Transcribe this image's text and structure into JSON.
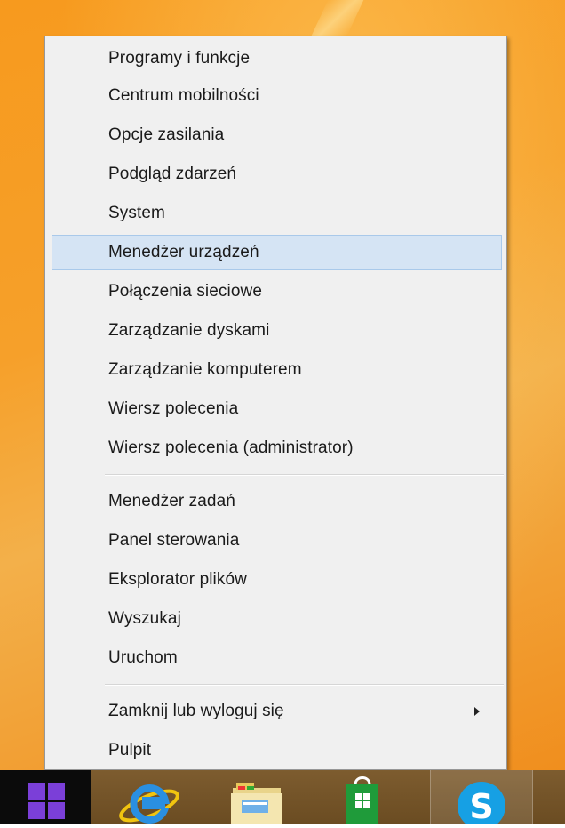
{
  "menu": {
    "group1": [
      {
        "label": "Programy i funkcje"
      },
      {
        "label": "Centrum mobilności"
      },
      {
        "label": "Opcje zasilania"
      },
      {
        "label": "Podgląd zdarzeń"
      },
      {
        "label": "System"
      },
      {
        "label": "Menedżer urządzeń"
      },
      {
        "label": "Połączenia sieciowe"
      },
      {
        "label": "Zarządzanie dyskami"
      },
      {
        "label": "Zarządzanie komputerem"
      },
      {
        "label": "Wiersz polecenia"
      },
      {
        "label": "Wiersz polecenia (administrator)"
      }
    ],
    "group2": [
      {
        "label": "Menedżer zadań"
      },
      {
        "label": "Panel sterowania"
      },
      {
        "label": "Eksplorator plików"
      },
      {
        "label": "Wyszukaj"
      },
      {
        "label": "Uruchom"
      }
    ],
    "group3": [
      {
        "label": "Zamknij lub wyloguj się"
      },
      {
        "label": "Pulpit"
      }
    ],
    "highlighted": "Menedżer urządzeń"
  },
  "taskbar": {
    "items": [
      {
        "icon": "start-windows-icon"
      },
      {
        "icon": "internet-explorer-icon"
      },
      {
        "icon": "file-explorer-icon"
      },
      {
        "icon": "windows-store-icon"
      },
      {
        "icon": "skype-icon"
      }
    ]
  },
  "colors": {
    "desktop": "#f6a02a",
    "menu_bg": "#f0f0f0",
    "highlight_bg": "#d5e4f4",
    "highlight_border": "#a9c9ea",
    "start_logo": "#7b3fd8",
    "taskbar": "#6b4c22"
  }
}
